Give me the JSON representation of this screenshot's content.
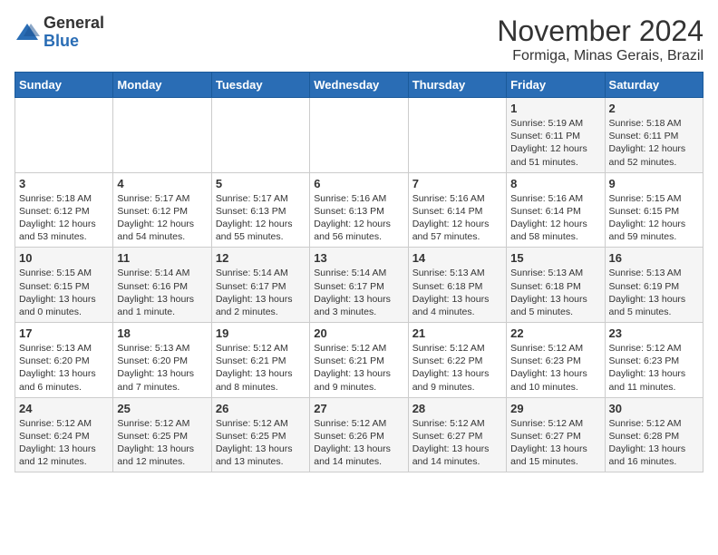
{
  "logo": {
    "general": "General",
    "blue": "Blue"
  },
  "header": {
    "month": "November 2024",
    "location": "Formiga, Minas Gerais, Brazil"
  },
  "weekdays": [
    "Sunday",
    "Monday",
    "Tuesday",
    "Wednesday",
    "Thursday",
    "Friday",
    "Saturday"
  ],
  "weeks": [
    [
      {
        "day": "",
        "info": ""
      },
      {
        "day": "",
        "info": ""
      },
      {
        "day": "",
        "info": ""
      },
      {
        "day": "",
        "info": ""
      },
      {
        "day": "",
        "info": ""
      },
      {
        "day": "1",
        "info": "Sunrise: 5:19 AM\nSunset: 6:11 PM\nDaylight: 12 hours\nand 51 minutes."
      },
      {
        "day": "2",
        "info": "Sunrise: 5:18 AM\nSunset: 6:11 PM\nDaylight: 12 hours\nand 52 minutes."
      }
    ],
    [
      {
        "day": "3",
        "info": "Sunrise: 5:18 AM\nSunset: 6:12 PM\nDaylight: 12 hours\nand 53 minutes."
      },
      {
        "day": "4",
        "info": "Sunrise: 5:17 AM\nSunset: 6:12 PM\nDaylight: 12 hours\nand 54 minutes."
      },
      {
        "day": "5",
        "info": "Sunrise: 5:17 AM\nSunset: 6:13 PM\nDaylight: 12 hours\nand 55 minutes."
      },
      {
        "day": "6",
        "info": "Sunrise: 5:16 AM\nSunset: 6:13 PM\nDaylight: 12 hours\nand 56 minutes."
      },
      {
        "day": "7",
        "info": "Sunrise: 5:16 AM\nSunset: 6:14 PM\nDaylight: 12 hours\nand 57 minutes."
      },
      {
        "day": "8",
        "info": "Sunrise: 5:16 AM\nSunset: 6:14 PM\nDaylight: 12 hours\nand 58 minutes."
      },
      {
        "day": "9",
        "info": "Sunrise: 5:15 AM\nSunset: 6:15 PM\nDaylight: 12 hours\nand 59 minutes."
      }
    ],
    [
      {
        "day": "10",
        "info": "Sunrise: 5:15 AM\nSunset: 6:15 PM\nDaylight: 13 hours\nand 0 minutes."
      },
      {
        "day": "11",
        "info": "Sunrise: 5:14 AM\nSunset: 6:16 PM\nDaylight: 13 hours\nand 1 minute."
      },
      {
        "day": "12",
        "info": "Sunrise: 5:14 AM\nSunset: 6:17 PM\nDaylight: 13 hours\nand 2 minutes."
      },
      {
        "day": "13",
        "info": "Sunrise: 5:14 AM\nSunset: 6:17 PM\nDaylight: 13 hours\nand 3 minutes."
      },
      {
        "day": "14",
        "info": "Sunrise: 5:13 AM\nSunset: 6:18 PM\nDaylight: 13 hours\nand 4 minutes."
      },
      {
        "day": "15",
        "info": "Sunrise: 5:13 AM\nSunset: 6:18 PM\nDaylight: 13 hours\nand 5 minutes."
      },
      {
        "day": "16",
        "info": "Sunrise: 5:13 AM\nSunset: 6:19 PM\nDaylight: 13 hours\nand 5 minutes."
      }
    ],
    [
      {
        "day": "17",
        "info": "Sunrise: 5:13 AM\nSunset: 6:20 PM\nDaylight: 13 hours\nand 6 minutes."
      },
      {
        "day": "18",
        "info": "Sunrise: 5:13 AM\nSunset: 6:20 PM\nDaylight: 13 hours\nand 7 minutes."
      },
      {
        "day": "19",
        "info": "Sunrise: 5:12 AM\nSunset: 6:21 PM\nDaylight: 13 hours\nand 8 minutes."
      },
      {
        "day": "20",
        "info": "Sunrise: 5:12 AM\nSunset: 6:21 PM\nDaylight: 13 hours\nand 9 minutes."
      },
      {
        "day": "21",
        "info": "Sunrise: 5:12 AM\nSunset: 6:22 PM\nDaylight: 13 hours\nand 9 minutes."
      },
      {
        "day": "22",
        "info": "Sunrise: 5:12 AM\nSunset: 6:23 PM\nDaylight: 13 hours\nand 10 minutes."
      },
      {
        "day": "23",
        "info": "Sunrise: 5:12 AM\nSunset: 6:23 PM\nDaylight: 13 hours\nand 11 minutes."
      }
    ],
    [
      {
        "day": "24",
        "info": "Sunrise: 5:12 AM\nSunset: 6:24 PM\nDaylight: 13 hours\nand 12 minutes."
      },
      {
        "day": "25",
        "info": "Sunrise: 5:12 AM\nSunset: 6:25 PM\nDaylight: 13 hours\nand 12 minutes."
      },
      {
        "day": "26",
        "info": "Sunrise: 5:12 AM\nSunset: 6:25 PM\nDaylight: 13 hours\nand 13 minutes."
      },
      {
        "day": "27",
        "info": "Sunrise: 5:12 AM\nSunset: 6:26 PM\nDaylight: 13 hours\nand 14 minutes."
      },
      {
        "day": "28",
        "info": "Sunrise: 5:12 AM\nSunset: 6:27 PM\nDaylight: 13 hours\nand 14 minutes."
      },
      {
        "day": "29",
        "info": "Sunrise: 5:12 AM\nSunset: 6:27 PM\nDaylight: 13 hours\nand 15 minutes."
      },
      {
        "day": "30",
        "info": "Sunrise: 5:12 AM\nSunset: 6:28 PM\nDaylight: 13 hours\nand 16 minutes."
      }
    ]
  ]
}
